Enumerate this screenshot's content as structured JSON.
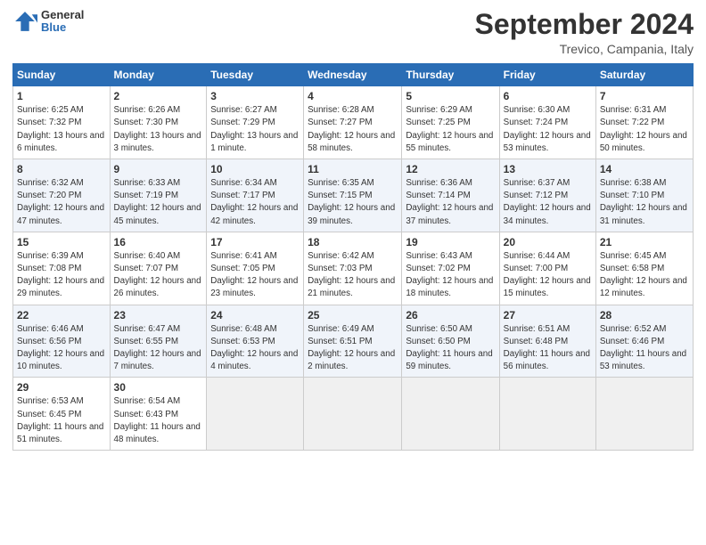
{
  "header": {
    "logo": {
      "line1": "General",
      "line2": "Blue"
    },
    "title": "September 2024",
    "location": "Trevico, Campania, Italy"
  },
  "weekdays": [
    "Sunday",
    "Monday",
    "Tuesday",
    "Wednesday",
    "Thursday",
    "Friday",
    "Saturday"
  ],
  "weeks": [
    [
      {
        "day": "1",
        "sunrise": "6:25 AM",
        "sunset": "7:32 PM",
        "daylight": "13 hours and 6 minutes."
      },
      {
        "day": "2",
        "sunrise": "6:26 AM",
        "sunset": "7:30 PM",
        "daylight": "13 hours and 3 minutes."
      },
      {
        "day": "3",
        "sunrise": "6:27 AM",
        "sunset": "7:29 PM",
        "daylight": "13 hours and 1 minute."
      },
      {
        "day": "4",
        "sunrise": "6:28 AM",
        "sunset": "7:27 PM",
        "daylight": "12 hours and 58 minutes."
      },
      {
        "day": "5",
        "sunrise": "6:29 AM",
        "sunset": "7:25 PM",
        "daylight": "12 hours and 55 minutes."
      },
      {
        "day": "6",
        "sunrise": "6:30 AM",
        "sunset": "7:24 PM",
        "daylight": "12 hours and 53 minutes."
      },
      {
        "day": "7",
        "sunrise": "6:31 AM",
        "sunset": "7:22 PM",
        "daylight": "12 hours and 50 minutes."
      }
    ],
    [
      {
        "day": "8",
        "sunrise": "6:32 AM",
        "sunset": "7:20 PM",
        "daylight": "12 hours and 47 minutes."
      },
      {
        "day": "9",
        "sunrise": "6:33 AM",
        "sunset": "7:19 PM",
        "daylight": "12 hours and 45 minutes."
      },
      {
        "day": "10",
        "sunrise": "6:34 AM",
        "sunset": "7:17 PM",
        "daylight": "12 hours and 42 minutes."
      },
      {
        "day": "11",
        "sunrise": "6:35 AM",
        "sunset": "7:15 PM",
        "daylight": "12 hours and 39 minutes."
      },
      {
        "day": "12",
        "sunrise": "6:36 AM",
        "sunset": "7:14 PM",
        "daylight": "12 hours and 37 minutes."
      },
      {
        "day": "13",
        "sunrise": "6:37 AM",
        "sunset": "7:12 PM",
        "daylight": "12 hours and 34 minutes."
      },
      {
        "day": "14",
        "sunrise": "6:38 AM",
        "sunset": "7:10 PM",
        "daylight": "12 hours and 31 minutes."
      }
    ],
    [
      {
        "day": "15",
        "sunrise": "6:39 AM",
        "sunset": "7:08 PM",
        "daylight": "12 hours and 29 minutes."
      },
      {
        "day": "16",
        "sunrise": "6:40 AM",
        "sunset": "7:07 PM",
        "daylight": "12 hours and 26 minutes."
      },
      {
        "day": "17",
        "sunrise": "6:41 AM",
        "sunset": "7:05 PM",
        "daylight": "12 hours and 23 minutes."
      },
      {
        "day": "18",
        "sunrise": "6:42 AM",
        "sunset": "7:03 PM",
        "daylight": "12 hours and 21 minutes."
      },
      {
        "day": "19",
        "sunrise": "6:43 AM",
        "sunset": "7:02 PM",
        "daylight": "12 hours and 18 minutes."
      },
      {
        "day": "20",
        "sunrise": "6:44 AM",
        "sunset": "7:00 PM",
        "daylight": "12 hours and 15 minutes."
      },
      {
        "day": "21",
        "sunrise": "6:45 AM",
        "sunset": "6:58 PM",
        "daylight": "12 hours and 12 minutes."
      }
    ],
    [
      {
        "day": "22",
        "sunrise": "6:46 AM",
        "sunset": "6:56 PM",
        "daylight": "12 hours and 10 minutes."
      },
      {
        "day": "23",
        "sunrise": "6:47 AM",
        "sunset": "6:55 PM",
        "daylight": "12 hours and 7 minutes."
      },
      {
        "day": "24",
        "sunrise": "6:48 AM",
        "sunset": "6:53 PM",
        "daylight": "12 hours and 4 minutes."
      },
      {
        "day": "25",
        "sunrise": "6:49 AM",
        "sunset": "6:51 PM",
        "daylight": "12 hours and 2 minutes."
      },
      {
        "day": "26",
        "sunrise": "6:50 AM",
        "sunset": "6:50 PM",
        "daylight": "11 hours and 59 minutes."
      },
      {
        "day": "27",
        "sunrise": "6:51 AM",
        "sunset": "6:48 PM",
        "daylight": "11 hours and 56 minutes."
      },
      {
        "day": "28",
        "sunrise": "6:52 AM",
        "sunset": "6:46 PM",
        "daylight": "11 hours and 53 minutes."
      }
    ],
    [
      {
        "day": "29",
        "sunrise": "6:53 AM",
        "sunset": "6:45 PM",
        "daylight": "11 hours and 51 minutes."
      },
      {
        "day": "30",
        "sunrise": "6:54 AM",
        "sunset": "6:43 PM",
        "daylight": "11 hours and 48 minutes."
      },
      null,
      null,
      null,
      null,
      null
    ]
  ]
}
